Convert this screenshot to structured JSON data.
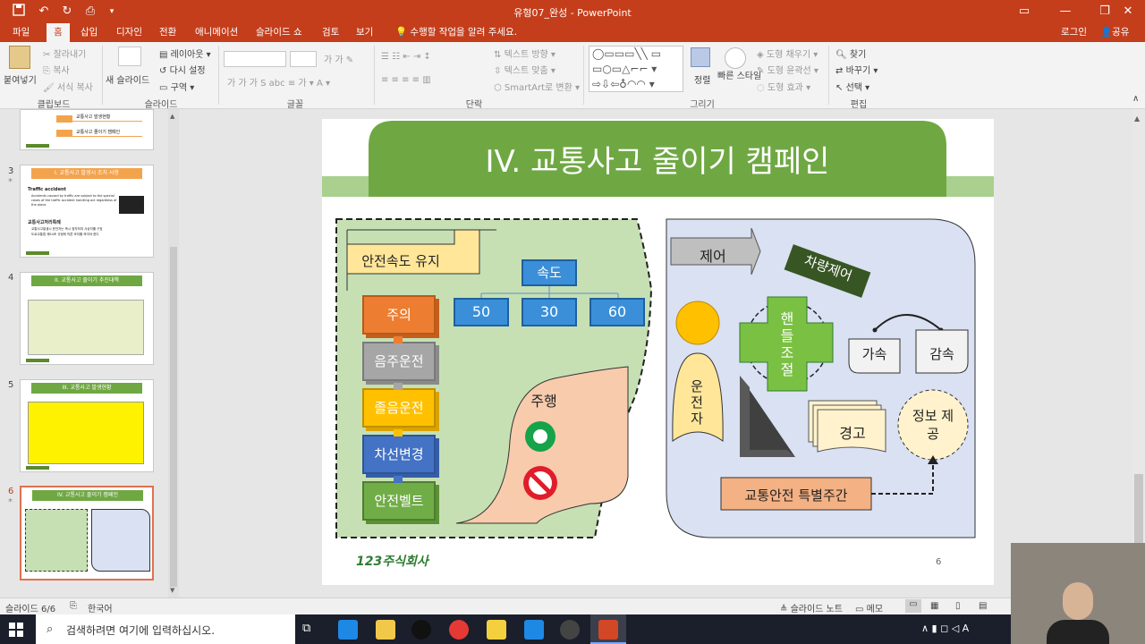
{
  "title_bar": {
    "title": "유형07_완성 - PowerPoint"
  },
  "tabs": [
    "파일",
    "홈",
    "삽입",
    "디자인",
    "전환",
    "애니메이션",
    "슬라이드 쇼",
    "검토",
    "보기"
  ],
  "tell_me": "수행할 작업을 알려 주세요.",
  "signin": "로그인",
  "share": "공유",
  "ribbon": {
    "clipboard": {
      "paste": "붙여넣기",
      "cut": "잘라내기",
      "copy": "복사",
      "format_painter": "서식 복사",
      "label": "클립보드"
    },
    "slides": {
      "new_slide": "새 슬라이드",
      "layout": "레이아웃",
      "reset": "다시 설정",
      "section": "구역",
      "label": "슬라이드"
    },
    "font": {
      "label": "글꼴",
      "small_glyphs": [
        "가",
        "가",
        "가",
        "가",
        "가"
      ]
    },
    "paragraph": {
      "text_direction": "텍스트 방향",
      "align_text": "텍스트 맞춤",
      "smartart": "SmartArt로 변환",
      "label": "단락"
    },
    "drawing": {
      "arrange": "정렬",
      "quick_styles": "빠른 스타일",
      "fill": "도형 채우기",
      "outline": "도형 윤곽선",
      "effects": "도형 효과",
      "label": "그리기"
    },
    "editing": {
      "find": "찾기",
      "replace": "바꾸기",
      "select": "선택",
      "label": "편집"
    }
  },
  "thumbnails": [
    {
      "num": "3",
      "title": "I. 교통사고 발생시 조치 사항",
      "lines": [
        "Traffic accident",
        "Accidents caused by traffic are subject to the",
        "special cases of the traffic accident handling act",
        "regardless of the place.",
        "교통사고처리특례",
        "교통사고발생시 운전자는 즉시 정차하여 사상자를 구호",
        "도로교통법 제54조 규정에 따른 조치를 하여야 한다"
      ]
    },
    {
      "num": "4",
      "title": "II. 교통사고 줄이기 추진대책"
    },
    {
      "num": "5",
      "title": "III. 교통사고 발생현황"
    },
    {
      "num": "6",
      "title": "IV. 교통사고 줄이기 캠페인"
    }
  ],
  "thumb_top_items": [
    "교통사고 발생현황",
    "교통사고 줄이기 캠페인"
  ],
  "slide": {
    "title": "IV. 교통사고 줄이기 캠페인",
    "safe_speed": "안전속도 유지",
    "speed": "속도",
    "speeds": [
      "50",
      "30",
      "60"
    ],
    "steps": [
      "주의",
      "음주운전",
      "졸음운전",
      "차선변경",
      "안전벨트"
    ],
    "driving": "주행",
    "control": "제어",
    "vehicle_control": "차량제어",
    "driver": "운전자",
    "steering": "핸들조절",
    "accel": "가속",
    "decel": "감속",
    "warning": "경고",
    "info": "정보 제공",
    "special_week": "교통안전 특별주간",
    "page_num": "6",
    "logo": "123주식회사"
  },
  "status": {
    "slide_count": "슬라이드 6/6",
    "language": "한국어",
    "notes": "슬라이드 노트",
    "comments": "메모"
  },
  "taskbar": {
    "search": "검색하려면 여기에 입력하십시오."
  },
  "colors": {
    "accent": "#c43e1c",
    "title_green": "#6fa843",
    "panel_green": "#c6e0b4",
    "panel_blue": "#d9e1f2"
  }
}
